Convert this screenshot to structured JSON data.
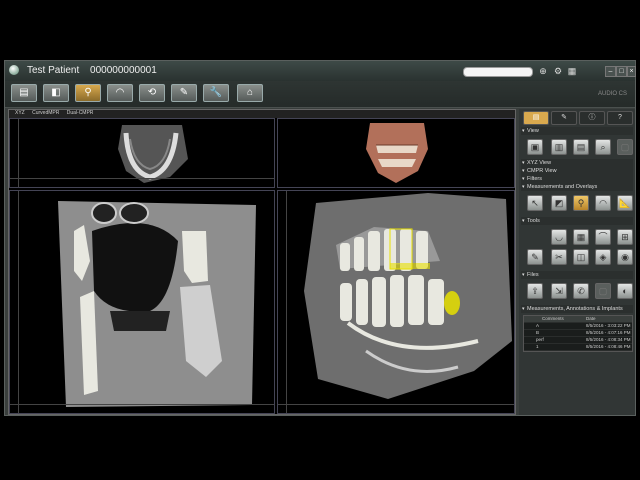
{
  "window": {
    "patient_name": "Test Patient",
    "patient_id": "000000000001",
    "logo_text": "AUDIO CS"
  },
  "toolbar": {
    "buttons": [
      "layout-icon",
      "slices-icon",
      "implant-icon",
      "panoramic-icon",
      "3d-rotate-icon",
      "report-icon",
      "tools-icon",
      "home-icon"
    ],
    "active_index": 2
  },
  "views": {
    "tabs": [
      "XYZ",
      "CurvedMPR",
      "Dual-CMPR"
    ]
  },
  "sidebar": {
    "view_label": "View",
    "xyz_view_label": "XYZ View",
    "cmpr_view_label": "CMPR View",
    "filters_label": "Filters",
    "measurements_overlays_label": "Measurements and Overlays",
    "tools_label": "Tools",
    "files_label": "Files",
    "annotations_label": "Measurements, Annotations & Implants",
    "annotations_table": {
      "headers": [
        "Comments",
        "Date"
      ],
      "rows": [
        {
          "name": "A",
          "date": "8/5/2016 - 3:03:22 PM"
        },
        {
          "name": "B",
          "date": "8/5/2016 - 4:07:16 PM"
        },
        {
          "name": "perf",
          "date": "8/5/2016 - 4:08:34 PM"
        },
        {
          "name": "1",
          "date": "8/5/2016 - 4:08:46 PM"
        }
      ]
    }
  },
  "colors": {
    "accent": "#d9a94e",
    "background": "#3a3f3d",
    "bone": "#e8e8e0",
    "highlight": "#e8e000"
  }
}
